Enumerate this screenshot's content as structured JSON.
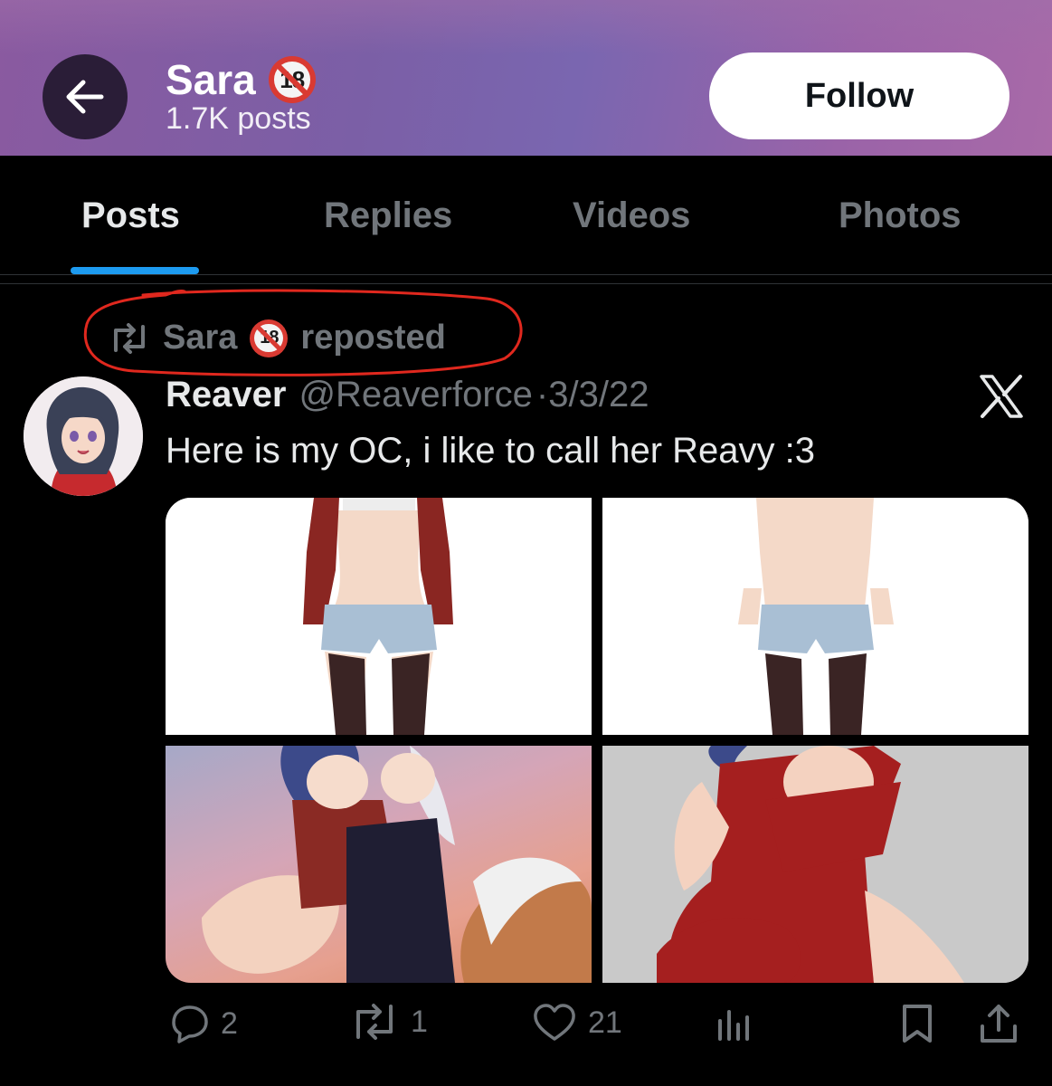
{
  "header": {
    "name": "Sara",
    "badge_text": "18",
    "posts_count": "1.7K posts",
    "follow_label": "Follow"
  },
  "tabs": [
    {
      "label": "Posts",
      "active": true
    },
    {
      "label": "Replies",
      "active": false
    },
    {
      "label": "Videos",
      "active": false
    },
    {
      "label": "Photos",
      "active": false
    }
  ],
  "repost_context": {
    "name": "Sara",
    "badge_text": "18",
    "suffix": "reposted"
  },
  "tweet": {
    "author_name": "Reaver",
    "handle": "@Reaverforce",
    "separator": "·",
    "date": "3/3/22",
    "text": "Here is my OC, i like to call her Reavy :3",
    "stats": {
      "replies": "2",
      "reposts": "1",
      "likes": "21"
    }
  },
  "colors": {
    "accent": "#1d9bf0",
    "muted_text": "#71767b",
    "annotation_circle": "#e0281e",
    "badge_red": "#d93a32"
  },
  "icons": {
    "back": "arrow-left-icon",
    "repost": "repost-icon",
    "platform": "x-logo-icon",
    "reply": "reply-icon",
    "like": "heart-icon",
    "views": "views-icon",
    "bookmark": "bookmark-icon",
    "share": "share-icon"
  }
}
